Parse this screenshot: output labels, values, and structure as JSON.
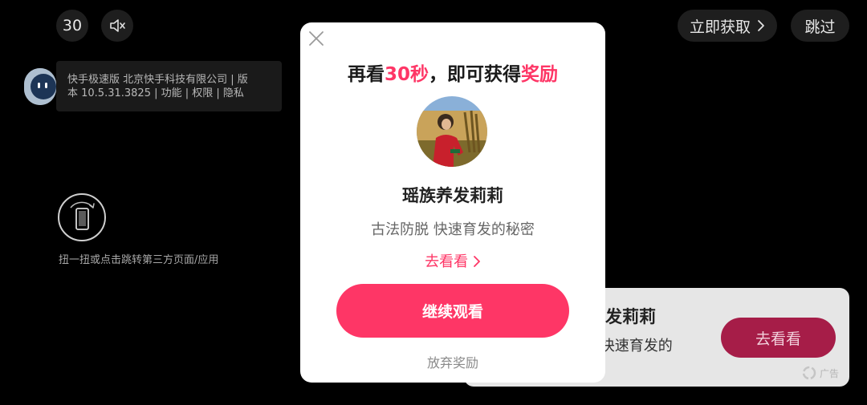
{
  "top_bar": {
    "countdown": "30",
    "mute_icon": "speaker-muted-icon",
    "get_now_label": "立即获取",
    "get_now_icon": "chevron-right-icon",
    "skip_label": "跳过"
  },
  "app_info": {
    "avatar_icon": "robot-avatar-icon",
    "line1": "快手极速版 北京快手科技有限公司 | 版",
    "line2": "本 10.5.31.3825 | 功能 | 权限 | 隐私"
  },
  "twist": {
    "icon": "phone-rotate-icon",
    "hint": "扭一扭或点击跳转第三方页面/应用"
  },
  "bottom_card": {
    "title_partial": "发莉莉",
    "desc_partial": "说 快速育发的",
    "cta": "去看看",
    "ad_label": "广告",
    "ad_icon": "ad-logo-icon"
  },
  "dialog": {
    "close_icon": "close-icon",
    "headline_pre": "再看",
    "headline_seconds": "30秒",
    "headline_mid": "，即可获得",
    "headline_reward": "奖励",
    "creator_name": "瑶族养发莉莉",
    "creator_desc": "古法防脱 快速育发的秘密",
    "go_watch": "去看看",
    "go_watch_icon": "chevron-right-icon",
    "continue_label": "继续观看",
    "give_up_label": "放弃奖励"
  },
  "colors": {
    "accent": "#fe3666",
    "cta_dark": "#a61d48",
    "background": "#000000"
  }
}
